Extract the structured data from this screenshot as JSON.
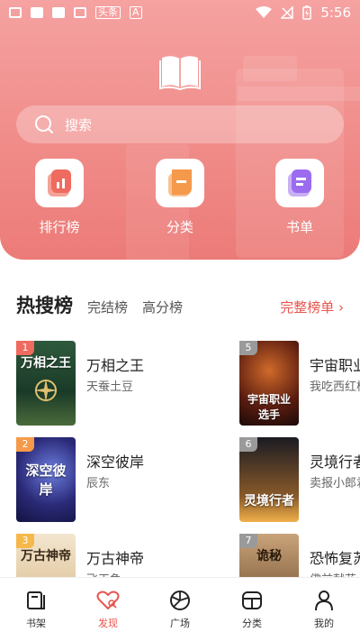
{
  "status": {
    "time": "5:56",
    "badge1": "头条",
    "badge2": "A"
  },
  "search": {
    "placeholder": "搜索"
  },
  "categories": [
    {
      "label": "排行榜",
      "icon": "chart-icon",
      "color": "#ef6a5f"
    },
    {
      "label": "分类",
      "icon": "category-icon",
      "color": "#f59a4a"
    },
    {
      "label": "书单",
      "icon": "booklist-icon",
      "color": "#9b6cf0"
    }
  ],
  "section": {
    "title": "热搜榜",
    "tabs": [
      "完结榜",
      "高分榜"
    ],
    "more": "完整榜单 ›"
  },
  "books": [
    {
      "rank": "1",
      "title": "万相之王",
      "author": "天蚕土豆",
      "cover_text": "万相之王"
    },
    {
      "rank": "2",
      "title": "深空彼岸",
      "author": "辰东",
      "cover_text": "深空彼岸"
    },
    {
      "rank": "3",
      "title": "万古神帝",
      "author": "飞天鱼",
      "cover_text": "万古神帝"
    },
    {
      "rank": "5",
      "title": "宇宙职业选手",
      "author": "我吃西红柿",
      "cover_text": "宇宙职业选手"
    },
    {
      "rank": "6",
      "title": "灵境行者",
      "author": "卖报小郎君",
      "cover_text": "灵境行者"
    },
    {
      "rank": "7",
      "title": "恐怖复苏",
      "author": "佛前献花",
      "cover_text": "诡秘"
    }
  ],
  "tabs": [
    {
      "label": "书架"
    },
    {
      "label": "发现"
    },
    {
      "label": "广场"
    },
    {
      "label": "分类"
    },
    {
      "label": "我的"
    }
  ],
  "colors": {
    "accent": "#e8554f",
    "header": "#f08c89"
  }
}
